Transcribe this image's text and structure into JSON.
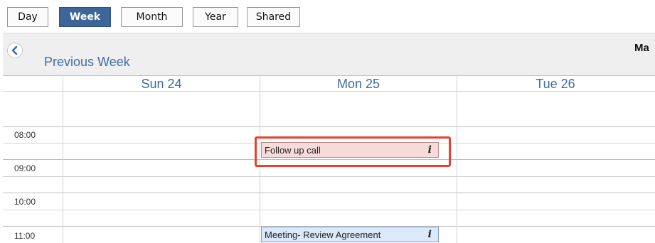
{
  "views": {
    "day": "Day",
    "week": "Week",
    "month": "Month",
    "year": "Year",
    "shared": "Shared",
    "active": "Week"
  },
  "navigation": {
    "previous_label": "Previous Week",
    "previous_icon": "chevron-left-icon",
    "month_label": "Ma"
  },
  "days": [
    "Sun 24",
    "Mon 25",
    "Tue 26"
  ],
  "times": [
    "08:00",
    "09:00",
    "10:00",
    "11:00"
  ],
  "events": [
    {
      "title": "Follow up call",
      "day": "Mon 25",
      "start": "08:30",
      "color": "#f7dada",
      "highlighted": true
    },
    {
      "title": "Meeting- Review Agreement",
      "day": "Mon 25",
      "start": "11:00",
      "color": "#dce9fb",
      "highlighted": false
    }
  ],
  "info_icon_glyph": "i",
  "colors": {
    "active_view": "#3c6699",
    "link": "#3e6ca8",
    "highlight": "#e8402d"
  }
}
